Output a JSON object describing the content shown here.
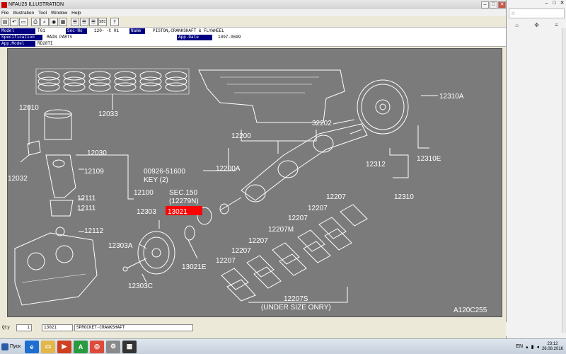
{
  "window": {
    "title": "NFAU25 ILLUSTRATION"
  },
  "menu": [
    "File",
    "Illustration",
    "Tool",
    "Window",
    "Help"
  ],
  "toolbar": {
    "icons": [
      "book-icon",
      "undo-icon",
      "doc-icon",
      "print-icon",
      "search-icon",
      "view-icon",
      "table-icon",
      "list-icon",
      "list-icon",
      "list-icon",
      "sec-icon",
      "help-icon"
    ],
    "sec_label": "SEC"
  },
  "info": {
    "model_label": "Model",
    "model_value": "T61",
    "secno_label": "Sec-No",
    "secno_value": "120-",
    "secno_suffix": "-C 01",
    "name_label": "Name",
    "name_value": "PISTON,CRANKSHAFT & FLYWHEEL",
    "spec_label": "Specification",
    "spec_value": "MAIN PARTS",
    "appdate_label": "App.Date",
    "appdate_value": "1097-0699",
    "appmodel_label": "App.Model",
    "appmodel_value": "RD28TI"
  },
  "diagram": {
    "code": "A120C255",
    "labels": {
      "p12033": "12033",
      "p12010": "12010",
      "p12032": "12032",
      "p12030": "12030",
      "p12109": "12109",
      "p12100": "12100",
      "p12111a": "12111",
      "p12111b": "12111",
      "p12112": "12112",
      "p12303": "12303",
      "p12303a": "12303A",
      "p12303c": "12303C",
      "p13021e": "13021E",
      "p13021": "13021",
      "sec150": "SEC.150",
      "sec150sub": "(12279N)",
      "p00926": "00926-51600",
      "key": "KEY (2)",
      "p12200a": "12200A",
      "p12200": "12200",
      "p32202": "32202",
      "p12310a": "12310A",
      "p12312": "12312",
      "p12310e": "12310E",
      "p12310": "12310",
      "p12207_1": "12207",
      "p12207_2": "12207",
      "p12207_3": "12207",
      "p12207_4": "12207",
      "p12207m": "12207M",
      "p12207_5": "12207",
      "p12207_6": "12207",
      "p12207s": "12207S",
      "undersize": "(UNDER SIZE ONRY)"
    }
  },
  "status": {
    "qty_label": "Qty",
    "qty_value": "1",
    "part_value": "13021",
    "part_name": "SPROCKET-CRANKSHAFT"
  },
  "browser": {
    "addr": "☆",
    "chrome": [
      "–",
      "□",
      "✕"
    ]
  },
  "taskbar": {
    "start": "Пуск",
    "lang": "EN",
    "time": "23:12",
    "date": "26.08.2016"
  },
  "colors": {
    "highlight": "#ff0000",
    "canvas": "#7b7b7b",
    "header_label": "#000080"
  }
}
